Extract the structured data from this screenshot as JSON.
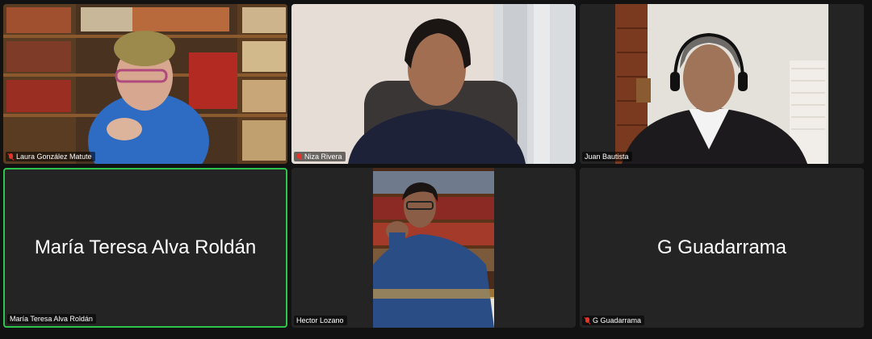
{
  "participants": [
    {
      "name": "Laura González Matute",
      "muted": true
    },
    {
      "name": "Niza Rivera",
      "muted": true
    },
    {
      "name": "Juan Bautista",
      "muted": false
    },
    {
      "name": "María Teresa Alva Roldán",
      "muted": false,
      "active_speaker": true,
      "display_name": "María Teresa Alva Roldán"
    },
    {
      "name": "Hector Lozano",
      "muted": false
    },
    {
      "name": "G Guadarrama",
      "muted": true,
      "display_name": "G Guadarrama"
    }
  ],
  "colors": {
    "active_border": "#2dc54d",
    "muted_icon": "#e5332a",
    "tile_bg": "#242424"
  },
  "icons": {
    "muted": "mic-muted-icon"
  }
}
